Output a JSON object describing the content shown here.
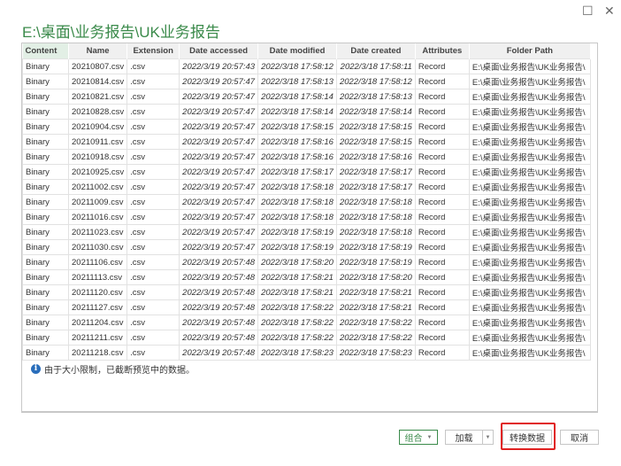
{
  "window": {
    "maximize_icon": "maximize-icon",
    "close_icon": "close-icon"
  },
  "title": "E:\\桌面\\业务报告\\UK业务报告",
  "columns": [
    "Content",
    "Name",
    "Extension",
    "Date accessed",
    "Date modified",
    "Date created",
    "Attributes",
    "Folder Path"
  ],
  "rows": [
    [
      "Binary",
      "20210807.csv",
      ".csv",
      "2022/3/19 20:57:43",
      "2022/3/18 17:58:12",
      "2022/3/18 17:58:11",
      "Record",
      "E:\\桌面\\业务报告\\UK业务报告\\"
    ],
    [
      "Binary",
      "20210814.csv",
      ".csv",
      "2022/3/19 20:57:47",
      "2022/3/18 17:58:13",
      "2022/3/18 17:58:12",
      "Record",
      "E:\\桌面\\业务报告\\UK业务报告\\"
    ],
    [
      "Binary",
      "20210821.csv",
      ".csv",
      "2022/3/19 20:57:47",
      "2022/3/18 17:58:14",
      "2022/3/18 17:58:13",
      "Record",
      "E:\\桌面\\业务报告\\UK业务报告\\"
    ],
    [
      "Binary",
      "20210828.csv",
      ".csv",
      "2022/3/19 20:57:47",
      "2022/3/18 17:58:14",
      "2022/3/18 17:58:14",
      "Record",
      "E:\\桌面\\业务报告\\UK业务报告\\"
    ],
    [
      "Binary",
      "20210904.csv",
      ".csv",
      "2022/3/19 20:57:47",
      "2022/3/18 17:58:15",
      "2022/3/18 17:58:15",
      "Record",
      "E:\\桌面\\业务报告\\UK业务报告\\"
    ],
    [
      "Binary",
      "20210911.csv",
      ".csv",
      "2022/3/19 20:57:47",
      "2022/3/18 17:58:16",
      "2022/3/18 17:58:15",
      "Record",
      "E:\\桌面\\业务报告\\UK业务报告\\"
    ],
    [
      "Binary",
      "20210918.csv",
      ".csv",
      "2022/3/19 20:57:47",
      "2022/3/18 17:58:16",
      "2022/3/18 17:58:16",
      "Record",
      "E:\\桌面\\业务报告\\UK业务报告\\"
    ],
    [
      "Binary",
      "20210925.csv",
      ".csv",
      "2022/3/19 20:57:47",
      "2022/3/18 17:58:17",
      "2022/3/18 17:58:17",
      "Record",
      "E:\\桌面\\业务报告\\UK业务报告\\"
    ],
    [
      "Binary",
      "20211002.csv",
      ".csv",
      "2022/3/19 20:57:47",
      "2022/3/18 17:58:18",
      "2022/3/18 17:58:17",
      "Record",
      "E:\\桌面\\业务报告\\UK业务报告\\"
    ],
    [
      "Binary",
      "20211009.csv",
      ".csv",
      "2022/3/19 20:57:47",
      "2022/3/18 17:58:18",
      "2022/3/18 17:58:18",
      "Record",
      "E:\\桌面\\业务报告\\UK业务报告\\"
    ],
    [
      "Binary",
      "20211016.csv",
      ".csv",
      "2022/3/19 20:57:47",
      "2022/3/18 17:58:18",
      "2022/3/18 17:58:18",
      "Record",
      "E:\\桌面\\业务报告\\UK业务报告\\"
    ],
    [
      "Binary",
      "20211023.csv",
      ".csv",
      "2022/3/19 20:57:47",
      "2022/3/18 17:58:19",
      "2022/3/18 17:58:18",
      "Record",
      "E:\\桌面\\业务报告\\UK业务报告\\"
    ],
    [
      "Binary",
      "20211030.csv",
      ".csv",
      "2022/3/19 20:57:47",
      "2022/3/18 17:58:19",
      "2022/3/18 17:58:19",
      "Record",
      "E:\\桌面\\业务报告\\UK业务报告\\"
    ],
    [
      "Binary",
      "20211106.csv",
      ".csv",
      "2022/3/19 20:57:48",
      "2022/3/18 17:58:20",
      "2022/3/18 17:58:19",
      "Record",
      "E:\\桌面\\业务报告\\UK业务报告\\"
    ],
    [
      "Binary",
      "20211113.csv",
      ".csv",
      "2022/3/19 20:57:48",
      "2022/3/18 17:58:21",
      "2022/3/18 17:58:20",
      "Record",
      "E:\\桌面\\业务报告\\UK业务报告\\"
    ],
    [
      "Binary",
      "20211120.csv",
      ".csv",
      "2022/3/19 20:57:48",
      "2022/3/18 17:58:21",
      "2022/3/18 17:58:21",
      "Record",
      "E:\\桌面\\业务报告\\UK业务报告\\"
    ],
    [
      "Binary",
      "20211127.csv",
      ".csv",
      "2022/3/19 20:57:48",
      "2022/3/18 17:58:22",
      "2022/3/18 17:58:21",
      "Record",
      "E:\\桌面\\业务报告\\UK业务报告\\"
    ],
    [
      "Binary",
      "20211204.csv",
      ".csv",
      "2022/3/19 20:57:48",
      "2022/3/18 17:58:22",
      "2022/3/18 17:58:22",
      "Record",
      "E:\\桌面\\业务报告\\UK业务报告\\"
    ],
    [
      "Binary",
      "20211211.csv",
      ".csv",
      "2022/3/19 20:57:48",
      "2022/3/18 17:58:22",
      "2022/3/18 17:58:22",
      "Record",
      "E:\\桌面\\业务报告\\UK业务报告\\"
    ],
    [
      "Binary",
      "20211218.csv",
      ".csv",
      "2022/3/19 20:57:48",
      "2022/3/18 17:58:23",
      "2022/3/18 17:58:23",
      "Record",
      "E:\\桌面\\业务报告\\UK业务报告\\"
    ]
  ],
  "note": "由于大小限制，已截断预览中的数据。",
  "buttons": {
    "combine": "组合",
    "load": "加载",
    "transform": "转换数据",
    "cancel": "取消"
  },
  "colors": {
    "title": "#3a8a4a",
    "highlight": "#e02020"
  }
}
